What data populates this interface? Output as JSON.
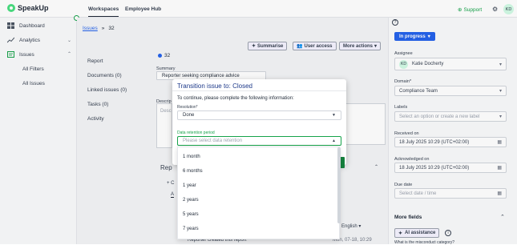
{
  "app": {
    "name": "SpeakUp"
  },
  "topnav": {
    "tabs": [
      "Workspaces",
      "Employee Hub"
    ],
    "support": "Support",
    "user_initials": "KD"
  },
  "sidebar": {
    "items": [
      {
        "label": "Dashboard",
        "icon": "grid-icon"
      },
      {
        "label": "Analytics",
        "icon": "chart-icon"
      },
      {
        "label": "Issues",
        "icon": "issues-icon"
      }
    ],
    "subitems": [
      "All Filters",
      "All Issues"
    ]
  },
  "breadcrumb": {
    "root": "Issues",
    "sep": "»",
    "current": "32"
  },
  "toolbar": {
    "summarise": "Summarise",
    "user_access": "User access",
    "more_actions": "More actions"
  },
  "issue_nav": [
    "Report",
    "Documents (0)",
    "Linked issues (0)",
    "Tasks (0)",
    "Activity"
  ],
  "issue": {
    "id": "32",
    "summary_label": "Summary",
    "summary": "Reporter seeking compliance advice",
    "description_label": "Descrip",
    "description_ph": "Desc",
    "reports_label": "Rep",
    "add": "+ C",
    "tab_a": "A",
    "language": "English",
    "activity_text": "Reporter created this report",
    "activity_date": "Mon, 07-18, 10:29"
  },
  "right_panel": {
    "status_button": "In progress",
    "assignee_label": "Assignee",
    "assignee_initials": "KD",
    "assignee_name": "Katie Docherty",
    "domain_label": "Domain*",
    "domain_value": "Compliance Team",
    "labels_label": "Labels",
    "labels_ph": "Select an option or create a new label",
    "received_label": "Received on",
    "received_value": "18 July 2025 10:29 (UTC+02:00)",
    "acknowledged_label": "Acknowledged on",
    "acknowledged_value": "18 July 2025 10:29 (UTC+02:00)",
    "due_label": "Due date",
    "due_ph": "Select date / time",
    "more_fields": "More fields",
    "ai_assistance": "AI assistance",
    "question": "What is the misconduct category?"
  },
  "modal": {
    "title": "Transition issue to: Closed",
    "instruction": "To continue, please complete the following information:",
    "resolution_label": "Resolution*",
    "resolution_value": "Done",
    "retention_label": "Data retention period",
    "retention_ph": "Please select data retention",
    "options": [
      "1 month",
      "6 months",
      "1 year",
      "2 years",
      "5 years",
      "7 years"
    ]
  },
  "colors": {
    "accent": "#2563eb",
    "brand": "#16a34a",
    "title": "#1e3a8a"
  }
}
